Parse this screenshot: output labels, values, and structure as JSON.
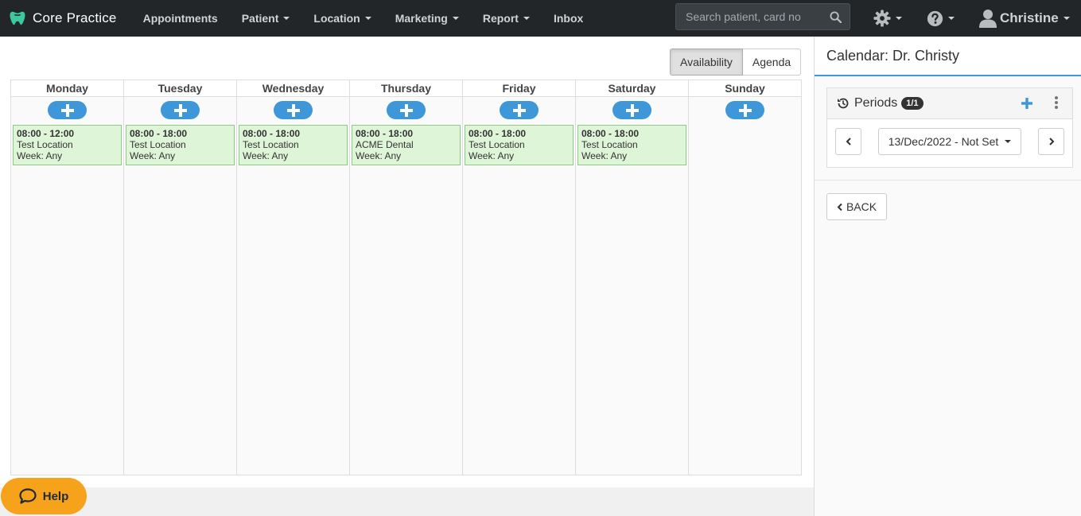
{
  "brand": {
    "name": "Core Practice"
  },
  "nav": {
    "items": [
      {
        "label": "Appointments",
        "caret": false
      },
      {
        "label": "Patient",
        "caret": true
      },
      {
        "label": "Location",
        "caret": true
      },
      {
        "label": "Marketing",
        "caret": true
      },
      {
        "label": "Report",
        "caret": true
      },
      {
        "label": "Inbox",
        "caret": false
      }
    ],
    "search_placeholder": "Search patient, card no",
    "user_name": "Christine"
  },
  "view_toggle": {
    "availability": "Availability",
    "agenda": "Agenda"
  },
  "calendar": {
    "days": [
      {
        "name": "Monday",
        "slot": {
          "time": "08:00 - 12:00",
          "location": "Test Location",
          "week": "Week: Any"
        }
      },
      {
        "name": "Tuesday",
        "slot": {
          "time": "08:00 - 18:00",
          "location": "Test Location",
          "week": "Week: Any"
        }
      },
      {
        "name": "Wednesday",
        "slot": {
          "time": "08:00 - 18:00",
          "location": "Test Location",
          "week": "Week: Any"
        }
      },
      {
        "name": "Thursday",
        "slot": {
          "time": "08:00 - 18:00",
          "location": "ACME Dental",
          "week": "Week: Any"
        }
      },
      {
        "name": "Friday",
        "slot": {
          "time": "08:00 - 18:00",
          "location": "Test Location",
          "week": "Week: Any"
        }
      },
      {
        "name": "Saturday",
        "slot": {
          "time": "08:00 - 18:00",
          "location": "Test Location",
          "week": "Week: Any"
        }
      },
      {
        "name": "Sunday"
      }
    ]
  },
  "side": {
    "title": "Calendar: Dr. Christy",
    "periods_label": "Periods",
    "periods_badge": "1/1",
    "period_value": "13/Dec/2022 - Not Set",
    "back_label": "BACK"
  },
  "help": {
    "label": "Help"
  },
  "colors": {
    "accent": "#3d97d9",
    "navbar": "#222629",
    "slot_bg": "#dff5d8",
    "help_bg": "#f7a21b"
  }
}
